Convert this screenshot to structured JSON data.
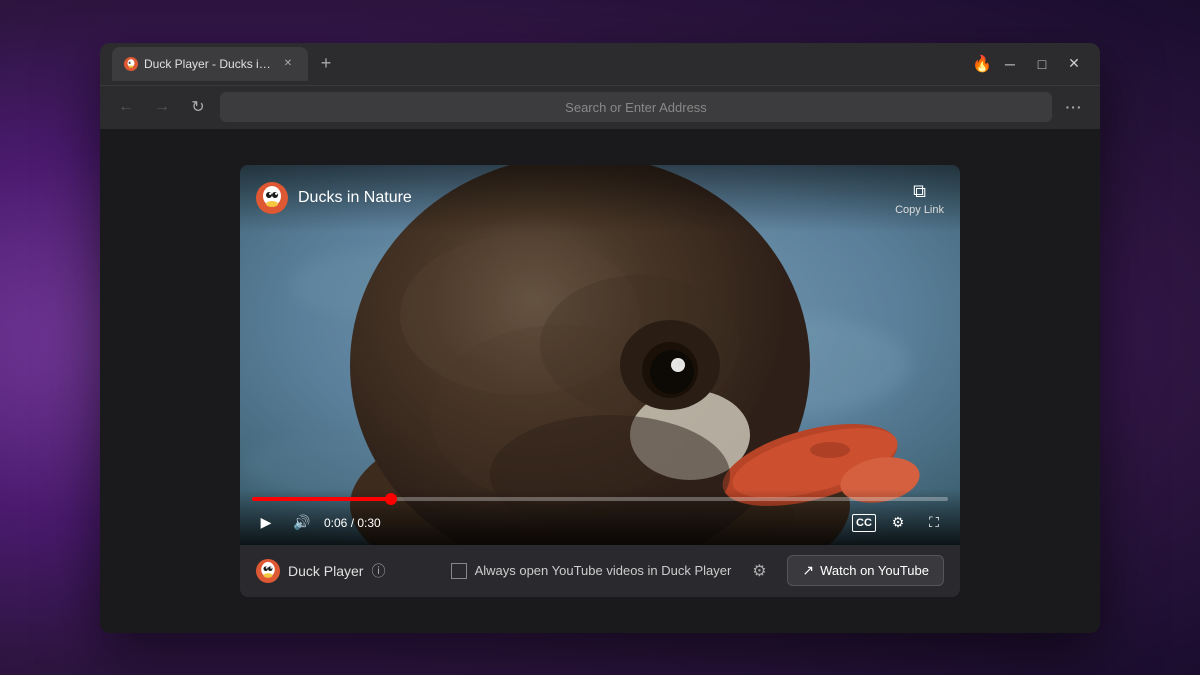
{
  "browser": {
    "title": "Duck Player - Ducks in Nature",
    "tab_label": "Duck Player - Ducks in Natur...",
    "address_placeholder": "Search or Enter Address",
    "menu_dots": "···"
  },
  "video": {
    "title": "Ducks in Nature",
    "copy_link_label": "Copy Link",
    "time_current": "0:06",
    "time_total": "0:30",
    "time_display": "0:06 / 0:30",
    "progress_percent": 20
  },
  "bottom_bar": {
    "duck_player_label": "Duck Player",
    "always_open_label": "Always open YouTube videos in Duck Player",
    "watch_youtube_label": "Watch on YouTube",
    "info_symbol": "ⓘ"
  },
  "icons": {
    "back": "←",
    "forward": "→",
    "refresh": "↻",
    "play": "▶",
    "volume": "🔊",
    "captions": "CC",
    "settings": "⚙",
    "fullscreen": "⛶",
    "copy": "⧉",
    "flame": "🔥",
    "minimize": "─",
    "maximize": "□",
    "close": "✕",
    "new_tab": "+",
    "tab_close": "✕",
    "external_link": "↗",
    "gear": "⚙"
  }
}
